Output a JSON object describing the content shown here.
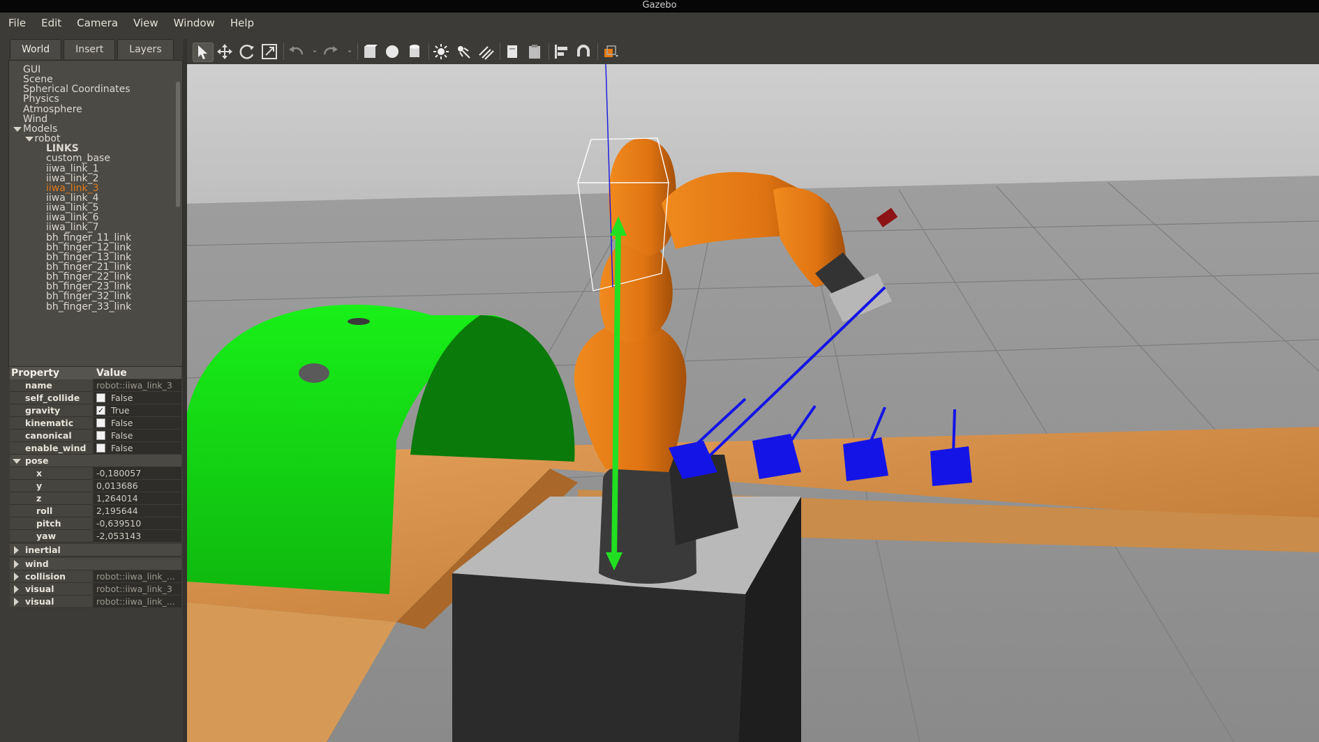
{
  "window": {
    "title": "Gazebo"
  },
  "menu": [
    "File",
    "Edit",
    "Camera",
    "View",
    "Window",
    "Help"
  ],
  "tabs": [
    "World",
    "Insert",
    "Layers"
  ],
  "tree": [
    {
      "label": "GUI",
      "indent": 0
    },
    {
      "label": "Scene",
      "indent": 0
    },
    {
      "label": "Spherical Coordinates",
      "indent": 0
    },
    {
      "label": "Physics",
      "indent": 0
    },
    {
      "label": "Atmosphere",
      "indent": 0
    },
    {
      "label": "Wind",
      "indent": 0
    },
    {
      "label": "Models",
      "indent": 0,
      "expanded": true
    },
    {
      "label": "robot",
      "indent": 1,
      "expanded": true
    },
    {
      "label": "LINKS",
      "indent": 2,
      "bold": true
    },
    {
      "label": "custom_base",
      "indent": 2
    },
    {
      "label": "iiwa_link_1",
      "indent": 2
    },
    {
      "label": "iiwa_link_2",
      "indent": 2
    },
    {
      "label": "iiwa_link_3",
      "indent": 2,
      "selected": true
    },
    {
      "label": "iiwa_link_4",
      "indent": 2
    },
    {
      "label": "iiwa_link_5",
      "indent": 2
    },
    {
      "label": "iiwa_link_6",
      "indent": 2
    },
    {
      "label": "iiwa_link_7",
      "indent": 2
    },
    {
      "label": "bh_finger_11_link",
      "indent": 2
    },
    {
      "label": "bh_finger_12_link",
      "indent": 2
    },
    {
      "label": "bh_finger_13_link",
      "indent": 2
    },
    {
      "label": "bh_finger_21_link",
      "indent": 2
    },
    {
      "label": "bh_finger_22_link",
      "indent": 2
    },
    {
      "label": "bh_finger_23_link",
      "indent": 2
    },
    {
      "label": "bh_finger_32_link",
      "indent": 2
    },
    {
      "label": "bh_finger_33_link",
      "indent": 2
    }
  ],
  "properties": {
    "header": {
      "name": "Property",
      "value": "Value"
    },
    "rows": [
      {
        "name": "name",
        "value": "robot::iiwa_link_3",
        "kind": "text"
      },
      {
        "name": "self_collide",
        "value": "False",
        "kind": "check",
        "checked": false
      },
      {
        "name": "gravity",
        "value": "True",
        "kind": "check",
        "checked": true
      },
      {
        "name": "kinematic",
        "value": "False",
        "kind": "check",
        "checked": false
      },
      {
        "name": "canonical",
        "value": "False",
        "kind": "check",
        "checked": false
      },
      {
        "name": "enable_wind",
        "value": "False",
        "kind": "check",
        "checked": false
      },
      {
        "name": "pose",
        "kind": "group",
        "expanded": true
      },
      {
        "name": "x",
        "value": "-0,180057",
        "kind": "sub"
      },
      {
        "name": "y",
        "value": "0,013686",
        "kind": "sub"
      },
      {
        "name": "z",
        "value": "1,264014",
        "kind": "sub"
      },
      {
        "name": "roll",
        "value": "2,195644",
        "kind": "sub"
      },
      {
        "name": "pitch",
        "value": "-0,639510",
        "kind": "sub"
      },
      {
        "name": "yaw",
        "value": "-2,053143",
        "kind": "sub"
      },
      {
        "name": "inertial",
        "kind": "group",
        "expanded": false
      },
      {
        "name": "wind",
        "kind": "group",
        "expanded": false
      },
      {
        "name": "collision",
        "value": "robot::iiwa_link_...",
        "kind": "groupval"
      },
      {
        "name": "visual",
        "value": "robot::iiwa_link_3",
        "kind": "groupval"
      },
      {
        "name": "visual",
        "value": "robot::iiwa_link_...",
        "kind": "groupval"
      }
    ]
  },
  "toolbar": [
    {
      "icon": "select-arrow-icon",
      "active": true
    },
    {
      "icon": "translate-icon"
    },
    {
      "icon": "rotate-icon"
    },
    {
      "icon": "scale-icon"
    },
    {
      "sep": true
    },
    {
      "icon": "undo-icon",
      "disabled": true
    },
    {
      "icon": "undo-dropdown-icon",
      "disabled": true
    },
    {
      "icon": "redo-icon",
      "disabled": true
    },
    {
      "icon": "redo-dropdown-icon",
      "disabled": true
    },
    {
      "sep": true
    },
    {
      "icon": "box-shape-icon"
    },
    {
      "icon": "sphere-shape-icon"
    },
    {
      "icon": "cylinder-shape-icon"
    },
    {
      "sep": true
    },
    {
      "icon": "point-light-icon"
    },
    {
      "icon": "spot-light-icon"
    },
    {
      "icon": "directional-light-icon"
    },
    {
      "sep": true
    },
    {
      "icon": "copy-icon"
    },
    {
      "icon": "paste-icon"
    },
    {
      "sep": true
    },
    {
      "icon": "align-icon"
    },
    {
      "icon": "snap-magnet-icon"
    },
    {
      "sep": true
    },
    {
      "icon": "view-angle-icon"
    }
  ],
  "colors": {
    "robot_orange": "#e87a12",
    "selection_green": "#21e021",
    "arch_green": "#12d812",
    "gripper_blue": "#1414e6",
    "selected_text": "#e07b1a"
  }
}
